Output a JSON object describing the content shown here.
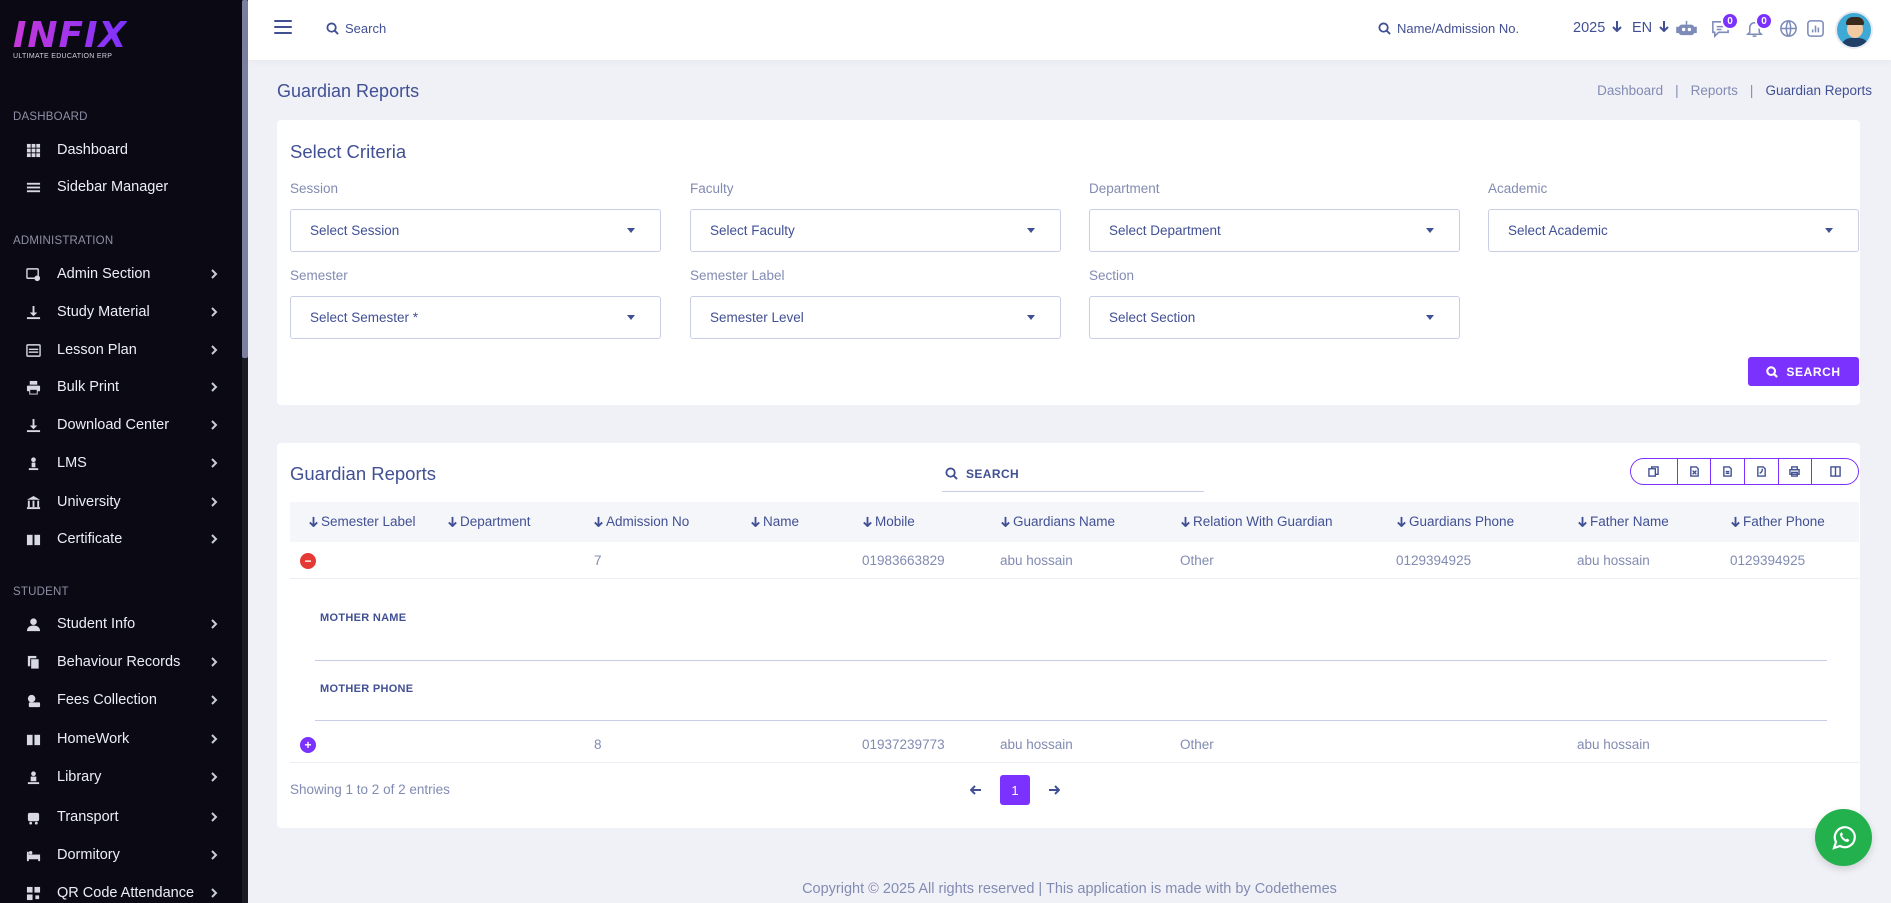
{
  "brand": {
    "logo_text": "INFIX",
    "tagline": "ULTIMATE EDUCATION ERP"
  },
  "sidebar": {
    "sections": [
      {
        "label": "DASHBOARD"
      },
      {
        "label": "ADMINISTRATION"
      },
      {
        "label": "STUDENT"
      }
    ],
    "items": [
      {
        "label": "Dashboard",
        "icon": "grid-icon"
      },
      {
        "label": "Sidebar Manager",
        "icon": "list-icon"
      },
      {
        "label": "Admin Section",
        "icon": "admin-icon"
      },
      {
        "label": "Study Material",
        "icon": "download-icon"
      },
      {
        "label": "Lesson Plan",
        "icon": "lesson-icon"
      },
      {
        "label": "Bulk Print",
        "icon": "print-icon"
      },
      {
        "label": "Download Center",
        "icon": "download-icon"
      },
      {
        "label": "LMS",
        "icon": "lms-icon"
      },
      {
        "label": "University",
        "icon": "university-icon"
      },
      {
        "label": "Certificate",
        "icon": "book-icon"
      },
      {
        "label": "Student Info",
        "icon": "user-icon"
      },
      {
        "label": "Behaviour Records",
        "icon": "records-icon"
      },
      {
        "label": "Fees Collection",
        "icon": "fees-icon"
      },
      {
        "label": "HomeWork",
        "icon": "book-icon"
      },
      {
        "label": "Library",
        "icon": "library-icon"
      },
      {
        "label": "Transport",
        "icon": "bus-icon"
      },
      {
        "label": "Dormitory",
        "icon": "bed-icon"
      },
      {
        "label": "QR Code Attendance",
        "icon": "qr-icon"
      }
    ]
  },
  "topbar": {
    "search_label": "Search",
    "name_search_label": "Name/Admission No.",
    "year": "2025",
    "language": "EN",
    "chat_badge": "0",
    "notification_badge": "0"
  },
  "page": {
    "title": "Guardian Reports",
    "breadcrumbs": [
      "Dashboard",
      "|",
      "Reports",
      "|",
      "Guardian Reports"
    ]
  },
  "criteria": {
    "title": "Select Criteria",
    "fields": [
      {
        "label": "Session",
        "value": "Select Session"
      },
      {
        "label": "Faculty",
        "value": "Select Faculty"
      },
      {
        "label": "Department",
        "value": "Select Department"
      },
      {
        "label": "Academic",
        "value": "Select Academic"
      },
      {
        "label": "Semester",
        "value": "Select Semester *"
      },
      {
        "label": "Semester Label",
        "value": "Semester Level"
      },
      {
        "label": "Section",
        "value": "Select Section"
      }
    ],
    "search_button": "SEARCH"
  },
  "report": {
    "title": "Guardian Reports",
    "search_label": "SEARCH",
    "toolbar": [
      "copy-icon",
      "excel-icon",
      "csv-icon",
      "pdf-icon",
      "print-icon",
      "columns-icon"
    ],
    "columns": [
      "Semester Label",
      "Department",
      "Admission No",
      "Name",
      "Mobile",
      "Guardians Name",
      "Relation With Guardian",
      "Guardians Phone",
      "Father Name",
      "Father Phone"
    ],
    "rows": [
      {
        "semester_label": "",
        "department": "",
        "admission_no": "7",
        "name": "",
        "mobile": "01983663829",
        "guardians_name": "abu hossain",
        "relation": "Other",
        "guardians_phone": "0129394925",
        "father_name": "abu hossain",
        "father_phone": "0129394925",
        "expanded": true
      },
      {
        "semester_label": "",
        "department": "",
        "admission_no": "8",
        "name": "",
        "mobile": "01937239773",
        "guardians_name": "abu hossain",
        "relation": "Other",
        "guardians_phone": "",
        "father_name": "abu hossain",
        "father_phone": "",
        "expanded": false
      }
    ],
    "child_rows": [
      {
        "title": "MOTHER NAME",
        "value": ""
      },
      {
        "title": "MOTHER PHONE",
        "value": ""
      }
    ],
    "info": "Showing 1 to 2 of 2 entries",
    "current_page": "1"
  },
  "footer": "Copyright © 2025 All rights reserved | This application is made with by Codethemes",
  "colors": {
    "accent": "#7c32ff",
    "text": "#415094",
    "muted": "#828bb2",
    "sidebar_bg": "#0b0a14",
    "whatsapp": "#23b14d"
  }
}
